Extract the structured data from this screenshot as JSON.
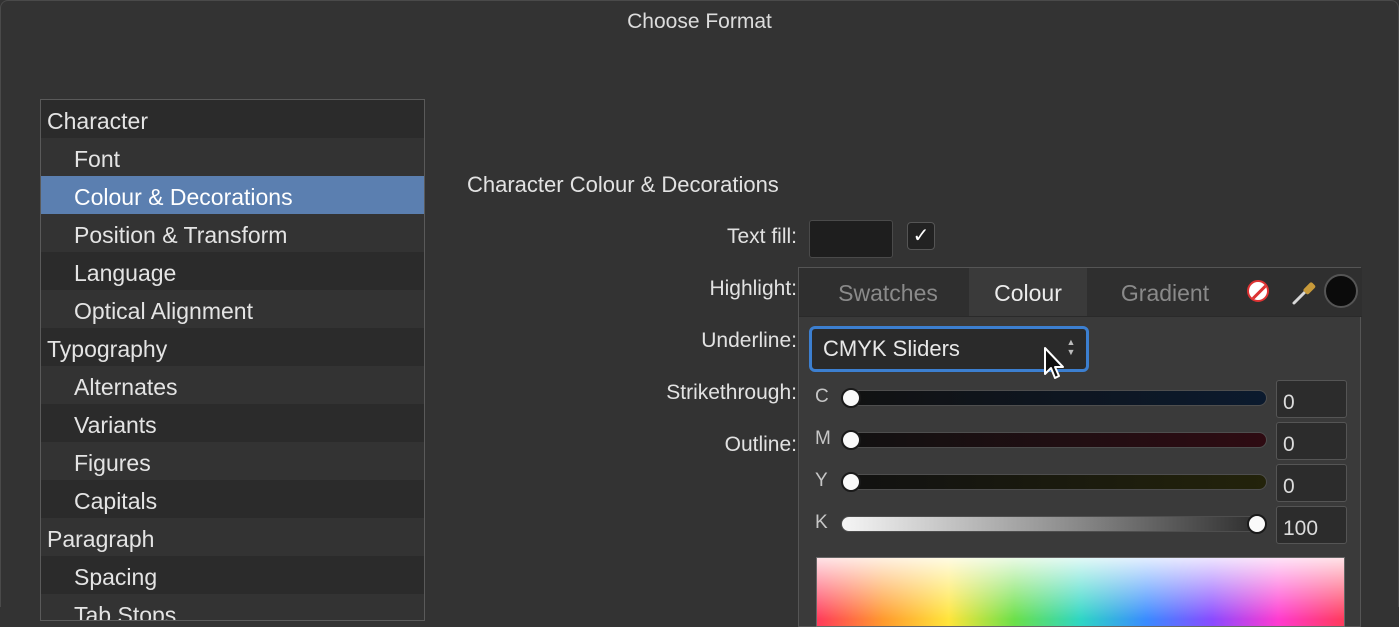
{
  "window": {
    "title": "Choose Format"
  },
  "sidebar": {
    "items": [
      {
        "label": "Character",
        "level": "category"
      },
      {
        "label": "Font",
        "level": "sub"
      },
      {
        "label": "Colour & Decorations",
        "level": "sub",
        "selected": true
      },
      {
        "label": "Position & Transform",
        "level": "sub"
      },
      {
        "label": "Language",
        "level": "sub"
      },
      {
        "label": "Optical Alignment",
        "level": "sub"
      },
      {
        "label": "Typography",
        "level": "category"
      },
      {
        "label": "Alternates",
        "level": "sub"
      },
      {
        "label": "Variants",
        "level": "sub"
      },
      {
        "label": "Figures",
        "level": "sub"
      },
      {
        "label": "Capitals",
        "level": "sub"
      },
      {
        "label": "Paragraph",
        "level": "category"
      },
      {
        "label": "Spacing",
        "level": "sub"
      },
      {
        "label": "Tab Stops",
        "level": "sub"
      }
    ]
  },
  "main": {
    "section_title": "Character Colour & Decorations",
    "labels": {
      "text_fill": "Text fill:",
      "highlight": "Highlight:",
      "underline": "Underline:",
      "strikethrough": "Strikethrough:",
      "outline": "Outline:"
    },
    "text_fill_checked": true,
    "checkbox_glyph": "✓"
  },
  "colour_panel": {
    "tabs": [
      "Swatches",
      "Colour",
      "Gradient"
    ],
    "active_tab": "Colour",
    "mode": "CMYK Sliders",
    "sliders": [
      {
        "letter": "C",
        "value": "0",
        "level": 0,
        "color": "#0b1a2e"
      },
      {
        "letter": "M",
        "value": "0",
        "level": 0,
        "color": "#2e0b12"
      },
      {
        "letter": "Y",
        "value": "0",
        "level": 0,
        "color": "#23230b"
      },
      {
        "letter": "K",
        "value": "100",
        "level": 1,
        "color": "#ffffff"
      }
    ],
    "current_colour": "#0b0b0b",
    "icons": [
      "no-fill-icon",
      "eyedropper-icon",
      "current-colour-swatch"
    ]
  }
}
